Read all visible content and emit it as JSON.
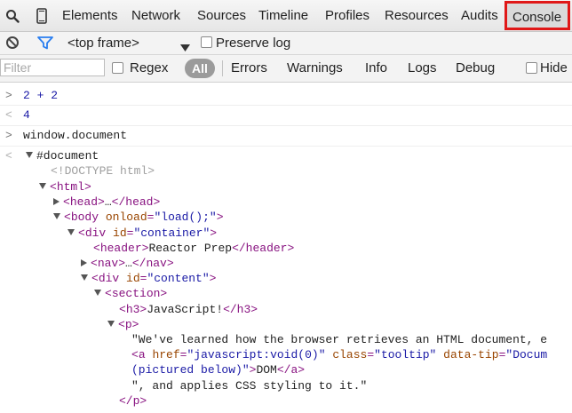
{
  "tabs": {
    "items": [
      "Elements",
      "Network",
      "Sources",
      "Timeline",
      "Profiles",
      "Resources",
      "Audits",
      "Console"
    ],
    "selected": "Console"
  },
  "icons": [
    "search-icon",
    "device-mode-icon",
    "clear-console-icon",
    "filter-funnel-icon",
    "dropdown-arrow-icon"
  ],
  "toolbar": {
    "frame_select": "<top frame>",
    "preserve_log": "Preserve log"
  },
  "filter": {
    "placeholder": "Filter",
    "regex": "Regex",
    "all": "All",
    "levels": [
      "Errors",
      "Warnings",
      "Info",
      "Logs",
      "Debug"
    ],
    "hide": "Hide"
  },
  "console": {
    "input1": "2 + 2",
    "result1": "4",
    "input2": "window.document",
    "dom": {
      "document": "#document",
      "doctype": "<!DOCTYPE html>",
      "html_tag": "html",
      "head_tag": "head",
      "head_ellipsis": "…",
      "body_tag": "body",
      "body_attr": "onload",
      "body_val": "\"load();\"",
      "div_tag": "div",
      "id_attr": "id",
      "container_val": "\"container\"",
      "header_tag": "header",
      "header_text": "Reactor Prep",
      "nav_tag": "nav",
      "nav_ellipsis": "…",
      "content_val": "\"content\"",
      "section_tag": "section",
      "h3_tag": "h3",
      "h3_text": "JavaScript!",
      "p_tag": "p",
      "p_text1": "\"We've learned how the browser retrieves an HTML document, e",
      "a_tag": "a",
      "href_attr": "href",
      "href_val": "\"javascript:void(0)\"",
      "class_attr": "class",
      "class_val": "\"tooltip\"",
      "datatip_attr": "data-tip",
      "datatip_val": "\"Docum",
      "datatip_cont": "(pictured below)\"",
      "a_text": "DOM",
      "p_text2": "\", and applies CSS styling to it.\""
    }
  }
}
